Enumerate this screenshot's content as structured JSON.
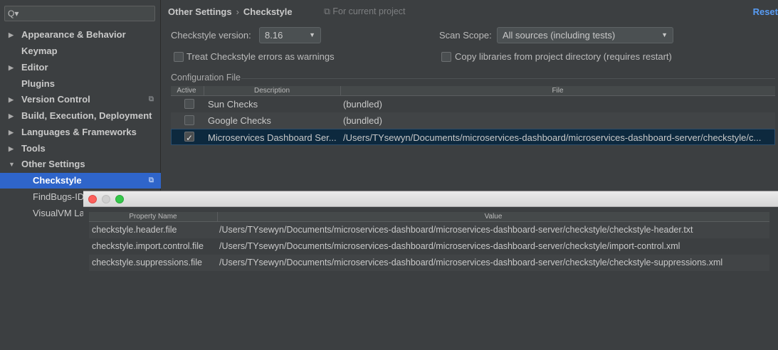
{
  "search": {
    "placeholder": "Q▾"
  },
  "sidebar": {
    "items": [
      {
        "label": "Appearance & Behavior",
        "expanded": false
      },
      {
        "label": "Keymap"
      },
      {
        "label": "Editor",
        "expanded": false
      },
      {
        "label": "Plugins"
      },
      {
        "label": "Version Control",
        "expanded": false
      },
      {
        "label": "Build, Execution, Deployment",
        "expanded": false
      },
      {
        "label": "Languages & Frameworks",
        "expanded": false
      },
      {
        "label": "Tools",
        "expanded": false
      },
      {
        "label": "Other Settings",
        "expanded": true
      },
      {
        "label": "Checkstyle",
        "selected": true
      },
      {
        "label": "FindBugs-IDEA"
      },
      {
        "label": "VisualVM Launcher"
      }
    ]
  },
  "header": {
    "crumb_parent": "Other Settings",
    "crumb_sep": "›",
    "crumb_current": "Checkstyle",
    "scope_note": "⧉ For current project",
    "reset_label": "Reset"
  },
  "settings": {
    "version_label": "Checkstyle version:",
    "version_value": "8.16",
    "scan_scope_label": "Scan Scope:",
    "scan_scope_value": "All sources (including tests)",
    "treat_errors_label": "Treat Checkstyle errors as warnings",
    "copy_libs_label": "Copy libraries from project directory (requires restart)"
  },
  "config": {
    "title": "Configuration File",
    "columns": [
      "Active",
      "Description",
      "File"
    ],
    "rows": [
      {
        "active": false,
        "description": "Sun Checks",
        "file": "(bundled)"
      },
      {
        "active": false,
        "description": "Google Checks",
        "file": "(bundled)"
      },
      {
        "active": true,
        "description": "Microservices Dashboard Ser...",
        "file": "/Users/TYsewyn/Documents/microservices-dashboard/microservices-dashboard-server/checkstyle/c..."
      }
    ]
  },
  "dialog": {
    "columns": [
      "Property Name",
      "Value"
    ],
    "rows": [
      {
        "name": "checkstyle.header.file",
        "value": "/Users/TYsewyn/Documents/microservices-dashboard/microservices-dashboard-server/checkstyle/checkstyle-header.txt"
      },
      {
        "name": "checkstyle.import.control.file",
        "value": "/Users/TYsewyn/Documents/microservices-dashboard/microservices-dashboard-server/checkstyle/import-control.xml"
      },
      {
        "name": "checkstyle.suppressions.file",
        "value": "/Users/TYsewyn/Documents/microservices-dashboard/microservices-dashboard-server/checkstyle/checkstyle-suppressions.xml"
      }
    ]
  },
  "colors": {
    "selection": "#2f65ca",
    "link": "#589df6",
    "close": "#fc605c",
    "minimize": "#cfcfcf",
    "zoom": "#34c84a"
  }
}
